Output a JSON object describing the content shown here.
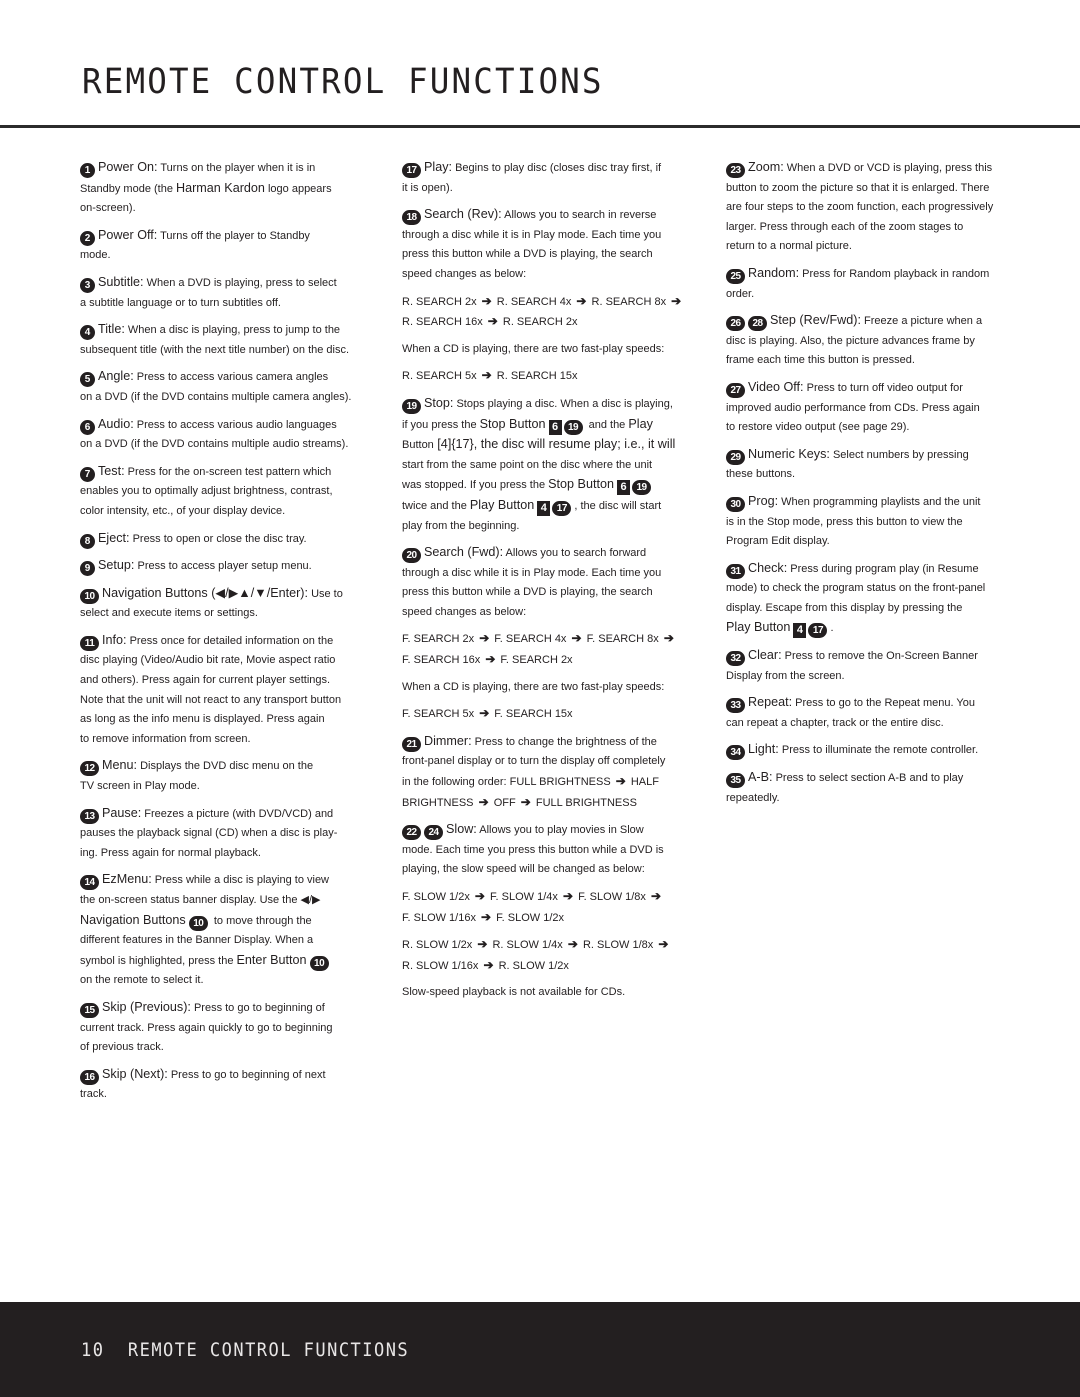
{
  "header": {
    "title": "REMOTE CONTROL FUNCTIONS"
  },
  "footer": {
    "page_number": "10",
    "section": "REMOTE CONTROL FUNCTIONS"
  },
  "arrow_icon": "➔",
  "columns": [
    [
      {
        "badges": [
          "1"
        ],
        "term": "Power On:",
        "lines": [
          "Turns on the player when it is in",
          "Standby mode (the |Harman Kardon| logo appears",
          "on-screen)."
        ]
      },
      {
        "badges": [
          "2"
        ],
        "term": "Power Off:",
        "lines": [
          "Turns off the player to Standby",
          "mode."
        ]
      },
      {
        "badges": [
          "3"
        ],
        "term": "Subtitle:",
        "lines": [
          "When a DVD is playing, press to select",
          "a subtitle language or to turn subtitles off."
        ]
      },
      {
        "badges": [
          "4"
        ],
        "term": "Title:",
        "lines": [
          "When a disc is playing, press to jump to the",
          "subsequent title (with the next title number) on the disc."
        ]
      },
      {
        "badges": [
          "5"
        ],
        "term": "Angle:",
        "lines": [
          "Press to access various camera angles",
          "on a DVD (if the DVD contains multiple camera angles)."
        ]
      },
      {
        "badges": [
          "6"
        ],
        "term": "Audio:",
        "lines": [
          "Press to access various audio languages",
          "on a DVD (if the DVD contains multiple audio streams)."
        ]
      },
      {
        "badges": [
          "7"
        ],
        "term": "Test:",
        "lines": [
          "Press for the on-screen test pattern which",
          "enables you to optimally adjust brightness, contrast,",
          "color intensity, etc., of your display device."
        ]
      },
      {
        "badges": [
          "8"
        ],
        "term": "Eject:",
        "lines": [
          "Press to open or close the disc tray."
        ]
      },
      {
        "badges": [
          "9"
        ],
        "term": "Setup:",
        "lines": [
          "Press to access player setup menu."
        ]
      },
      {
        "badges": [
          "10"
        ],
        "term": "Navigation Buttons (◀/▶▲/▼/Enter):",
        "lines": [
          "Use to",
          "select and execute items or settings."
        ]
      },
      {
        "badges": [
          "11"
        ],
        "term": "Info:",
        "lines": [
          "Press once for detailed information on the",
          "disc playing (Video/Audio bit rate, Movie aspect ratio",
          "and others). Press again for current player settings.",
          "Note that the unit will not react to any transport button",
          "as long as the info menu is displayed. Press again",
          "to remove information from screen."
        ]
      },
      {
        "badges": [
          "12"
        ],
        "term": "Menu:",
        "lines": [
          "Displays the DVD disc menu on the",
          "TV screen in Play mode."
        ]
      },
      {
        "badges": [
          "13"
        ],
        "term": "Pause:",
        "lines": [
          "Freezes a picture (with DVD/VCD) and",
          "pauses the playback signal (CD) when a disc is play-",
          "ing. Press again for normal playback."
        ]
      },
      {
        "badges": [
          "14"
        ],
        "term": "EzMenu:",
        "lines": [
          "Press while a disc is playing to view",
          "the on-screen status banner display. Use the ◀/▶",
          "|Navigation Buttons| {10} to move through the",
          "different features in the Banner Display. When a",
          "symbol is highlighted, press the |Enter Button| {10}",
          "on the remote to select it."
        ]
      },
      {
        "badges": [
          "15"
        ],
        "term": "Skip (Previous):",
        "lines": [
          "Press to go to beginning of",
          "current track. Press again quickly to go to beginning",
          "of previous track."
        ]
      },
      {
        "badges": [
          "16"
        ],
        "term": "Skip (Next):",
        "lines": [
          "Press to go to beginning of next",
          "track."
        ]
      }
    ],
    [
      {
        "badges": [
          "17"
        ],
        "term": "Play:",
        "lines": [
          "Begins to play disc (closes disc tray first, if",
          "it is open)."
        ]
      },
      {
        "badges": [
          "18"
        ],
        "term": "Search (Rev):",
        "lines": [
          "Allows you to search in reverse",
          "through a disc while it is in Play mode. Each time you",
          "press this button while a DVD is playing, the search",
          "speed changes as below:"
        ]
      },
      {
        "badges": [],
        "term": "",
        "lines": [
          "R. SEARCH 2x ➔ R. SEARCH 4x ➔ R. SEARCH 8x ➔",
          "R. SEARCH 16x ➔ R. SEARCH 2x"
        ]
      },
      {
        "badges": [],
        "term": "",
        "lines": [
          "When a CD is playing, there are two fast-play speeds:"
        ]
      },
      {
        "badges": [],
        "term": "",
        "lines": [
          "R. SEARCH 5x ➔ R. SEARCH 15x"
        ]
      },
      {
        "badges": [
          "19"
        ],
        "term": "Stop:",
        "lines": [
          "Stops playing a disc. When a disc is playing,",
          "if you press the |Stop Button| [6]{19} and the |Play",
          "Button| [4]{17}, the disc will resume play; i.e., it will",
          "start from the same point on the disc where the unit",
          "was stopped. If you press the |Stop Button| [6]{19}",
          "twice and the |Play Button| [4]{17}, the disc will start",
          "play from the beginning."
        ]
      },
      {
        "badges": [
          "20"
        ],
        "term": "Search (Fwd):",
        "lines": [
          "Allows you to search forward",
          "through a disc while it is in Play mode. Each time you",
          "press this button while a DVD is playing, the search",
          "speed changes as below:"
        ]
      },
      {
        "badges": [],
        "term": "",
        "lines": [
          "F. SEARCH 2x ➔ F. SEARCH 4x ➔ F. SEARCH 8x ➔",
          "F. SEARCH 16x ➔ F. SEARCH 2x"
        ]
      },
      {
        "badges": [],
        "term": "",
        "lines": [
          "When a CD is playing, there are two fast-play speeds:"
        ]
      },
      {
        "badges": [],
        "term": "",
        "lines": [
          "F. SEARCH 5x ➔ F. SEARCH 15x"
        ]
      },
      {
        "badges": [
          "21"
        ],
        "term": "Dimmer:",
        "lines": [
          "Press to change the brightness of the",
          "front-panel display or to turn the display off completely",
          "in the following order: FULL BRIGHTNESS ➔ HALF",
          "BRIGHTNESS ➔ OFF ➔ FULL BRIGHTNESS"
        ]
      },
      {
        "badges": [
          "22",
          "24"
        ],
        "term": "Slow:",
        "lines": [
          "Allows you to play movies in Slow",
          "mode. Each time you press this button while a DVD is",
          "playing, the slow speed will be changed as below:"
        ]
      },
      {
        "badges": [],
        "term": "",
        "lines": [
          "F. SLOW 1/2x ➔ F. SLOW 1/4x ➔ F. SLOW 1/8x ➔",
          "F. SLOW 1/16x ➔ F. SLOW 1/2x"
        ]
      },
      {
        "badges": [],
        "term": "",
        "lines": [
          "R. SLOW 1/2x ➔ R. SLOW 1/4x ➔ R. SLOW 1/8x ➔",
          "R. SLOW 1/16x ➔ R. SLOW 1/2x"
        ]
      },
      {
        "badges": [],
        "term": "",
        "lines": [
          "Slow-speed playback is not available for CDs."
        ]
      }
    ],
    [
      {
        "badges": [
          "23"
        ],
        "term": "Zoom:",
        "lines": [
          "When a DVD or VCD is playing, press this",
          "button to zoom the picture so that it is enlarged. There",
          "are four steps to the zoom function, each progressively",
          "larger. Press through each of the zoom stages to",
          "return to a normal picture."
        ]
      },
      {
        "badges": [
          "25"
        ],
        "term": "Random:",
        "lines": [
          "Press for Random playback in random",
          "order."
        ]
      },
      {
        "badges": [
          "26",
          "28"
        ],
        "term": "Step (Rev/Fwd):",
        "lines": [
          "Freeze a picture when a",
          "disc is playing. Also, the picture advances frame by",
          "frame each time this button is pressed."
        ]
      },
      {
        "badges": [
          "27"
        ],
        "term": "Video Off:",
        "lines": [
          "Press to turn off video output for",
          "improved audio performance from CDs. Press again",
          "to restore video output (see page 29)."
        ]
      },
      {
        "badges": [
          "29"
        ],
        "term": "Numeric Keys:",
        "lines": [
          "Select numbers by pressing",
          "these buttons."
        ]
      },
      {
        "badges": [
          "30"
        ],
        "term": "Prog:",
        "lines": [
          "When programming playlists and the unit",
          "is in the Stop mode, press this button to view the",
          "Program Edit display."
        ]
      },
      {
        "badges": [
          "31"
        ],
        "term": "Check:",
        "lines": [
          "Press during program play (in Resume",
          "mode) to check the program status on the front-panel",
          "display. Escape from this display by pressing the",
          "|Play Button| [4]{17}."
        ]
      },
      {
        "badges": [
          "32"
        ],
        "term": "Clear:",
        "lines": [
          "Press to remove the On-Screen Banner",
          "Display from the screen."
        ]
      },
      {
        "badges": [
          "33"
        ],
        "term": "Repeat:",
        "lines": [
          "Press to go to the Repeat menu. You",
          "can repeat a chapter, track or the entire disc."
        ]
      },
      {
        "badges": [
          "34"
        ],
        "term": "Light:",
        "lines": [
          "Press to illuminate the remote controller."
        ]
      },
      {
        "badges": [
          "35"
        ],
        "term": "A-B:",
        "lines": [
          "Press to select section A-B and to play",
          "repeatedly."
        ]
      }
    ]
  ]
}
